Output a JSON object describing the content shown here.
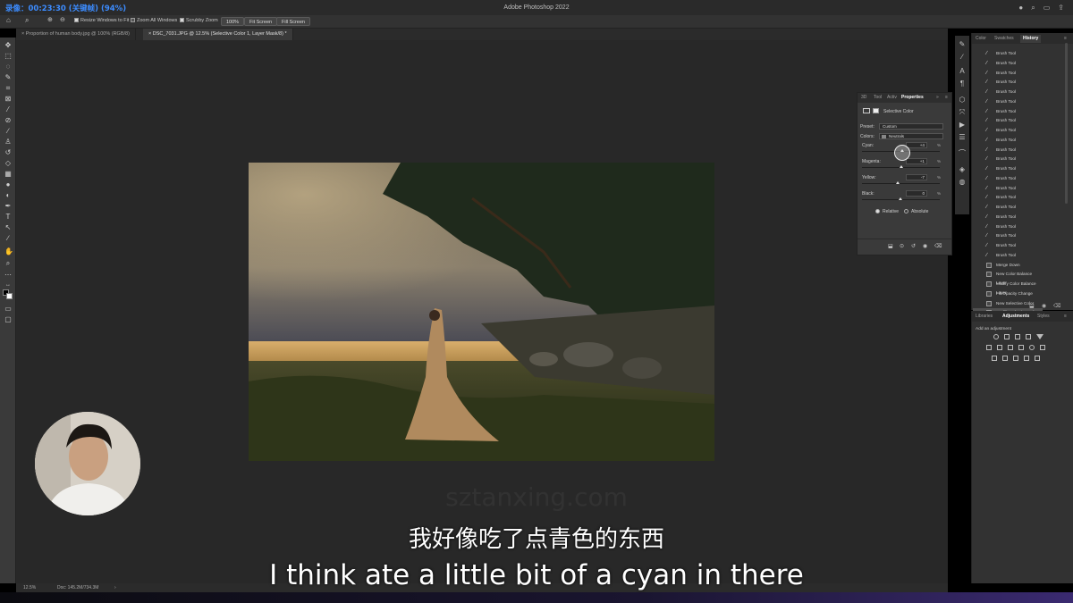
{
  "recording": {
    "label": "录像：00:23:30 (关键帧) (94%)"
  },
  "app": {
    "title": "Adobe Photoshop 2022"
  },
  "options_bar": {
    "resize_windows": "Resize Windows to Fit",
    "zoom_all": "Zoom All Windows",
    "scrubby_zoom": "Scrubby Zoom",
    "zoom_value": "100%",
    "fit_screen": "Fit Screen",
    "fill_screen": "Fill Screen"
  },
  "doc_tabs": [
    {
      "label": "Proportion of human body.jpg @ 100% (RGB/8)",
      "close": "×"
    },
    {
      "label": "DSC_7031.JPG @ 12.5% (Selective Color 1, Layer Mask/8) *",
      "close": "×"
    }
  ],
  "status": {
    "zoom": "12.5%",
    "doc": "Doc: 145.2M/734.3M",
    "arrow": "›"
  },
  "properties": {
    "tabs": [
      "3D",
      "Tool",
      "Activ",
      "Properties"
    ],
    "collapse": "»",
    "menu": "≡",
    "header": "Selective Color",
    "preset_label": "Preset:",
    "preset_value": "Custom",
    "colors_label": "Colors:",
    "colors_value": "Neutrals",
    "sliders": [
      {
        "label": "Cyan:",
        "value": "+4",
        "unit": "%",
        "level": 0.52
      },
      {
        "label": "Magenta:",
        "value": "+1",
        "unit": "%",
        "level": 0.505
      },
      {
        "label": "Yellow:",
        "value": "-7",
        "unit": "%",
        "level": 0.465
      },
      {
        "label": "Black:",
        "value": "0",
        "unit": "%",
        "level": 0.5
      }
    ],
    "relative": "Relative",
    "absolute": "Absolute"
  },
  "history": {
    "tabs": [
      "Color",
      "Swatches",
      "History"
    ],
    "menu": "≡",
    "items": [
      {
        "label": "Brush Tool",
        "type": "brush"
      },
      {
        "label": "Brush Tool",
        "type": "brush"
      },
      {
        "label": "Brush Tool",
        "type": "brush"
      },
      {
        "label": "Brush Tool",
        "type": "brush"
      },
      {
        "label": "Brush Tool",
        "type": "brush"
      },
      {
        "label": "Brush Tool",
        "type": "brush"
      },
      {
        "label": "Brush Tool",
        "type": "brush"
      },
      {
        "label": "Brush Tool",
        "type": "brush"
      },
      {
        "label": "Brush Tool",
        "type": "brush"
      },
      {
        "label": "Brush Tool",
        "type": "brush"
      },
      {
        "label": "Brush Tool",
        "type": "brush"
      },
      {
        "label": "Brush Tool",
        "type": "brush"
      },
      {
        "label": "Brush Tool",
        "type": "brush"
      },
      {
        "label": "Brush Tool",
        "type": "brush"
      },
      {
        "label": "Brush Tool",
        "type": "brush"
      },
      {
        "label": "Brush Tool",
        "type": "brush"
      },
      {
        "label": "Brush Tool",
        "type": "brush"
      },
      {
        "label": "Brush Tool",
        "type": "brush"
      },
      {
        "label": "Brush Tool",
        "type": "brush"
      },
      {
        "label": "Brush Tool",
        "type": "brush"
      },
      {
        "label": "Brush Tool",
        "type": "brush"
      },
      {
        "label": "Brush Tool",
        "type": "brush"
      },
      {
        "label": "Merge Down",
        "type": "doc"
      },
      {
        "label": "New Color Balance Layer",
        "type": "doc"
      },
      {
        "label": "Modify Color Balance Layer",
        "type": "doc"
      },
      {
        "label": "Fill Opacity Change",
        "type": "doc"
      },
      {
        "label": "New Selective Color Layer",
        "type": "doc"
      },
      {
        "label": "Modify Selective Color Layer",
        "type": "doc",
        "selected": true
      }
    ]
  },
  "adjustments": {
    "tabs": [
      "Libraries",
      "Adjustments",
      "Styles"
    ],
    "menu": "≡",
    "add_label": "Add an adjustment"
  },
  "subtitles": {
    "chinese": "我好像吃了点青色的东西",
    "english": "I think ate a little bit of a cyan in there",
    "watermark": "sztanxing.com"
  }
}
